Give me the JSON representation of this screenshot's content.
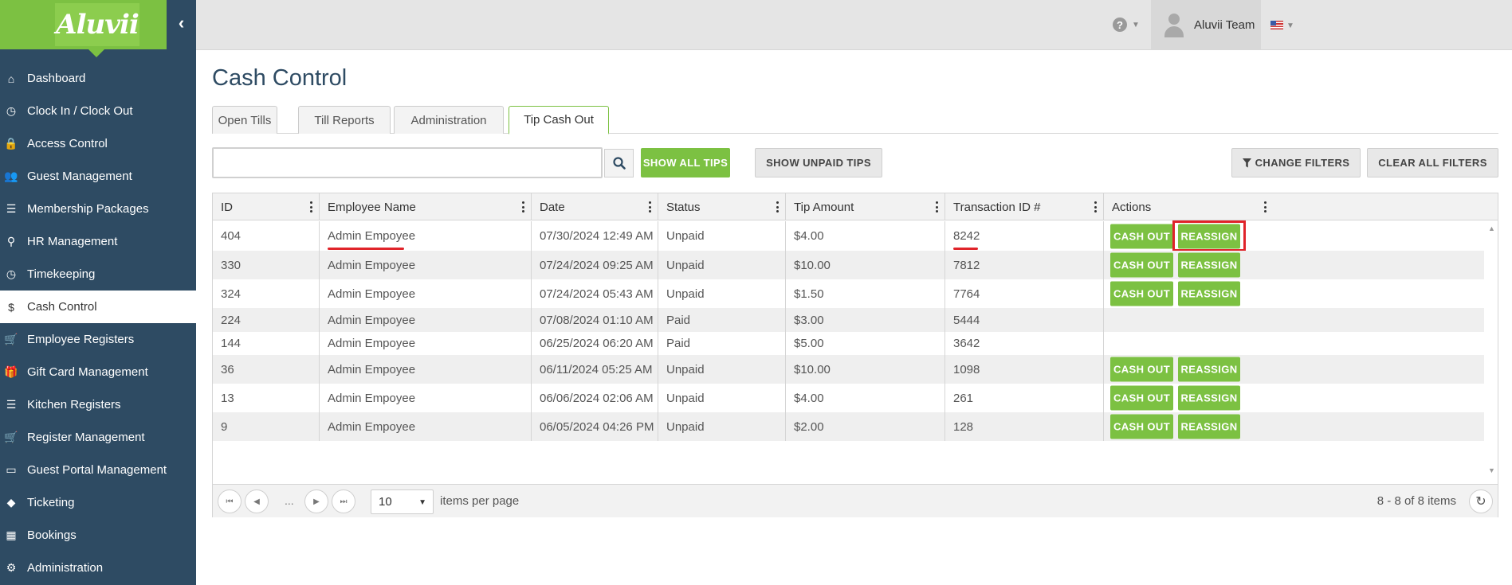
{
  "app": {
    "logo_text": "Aluvii"
  },
  "sidebar": {
    "items": [
      {
        "label": "Dashboard",
        "icon": "home-icon"
      },
      {
        "label": "Clock In / Clock Out",
        "icon": "clock-icon"
      },
      {
        "label": "Access Control",
        "icon": "lock-icon"
      },
      {
        "label": "Guest Management",
        "icon": "users-icon"
      },
      {
        "label": "Membership Packages",
        "icon": "list-icon"
      },
      {
        "label": "HR Management",
        "icon": "hr-icon"
      },
      {
        "label": "Timekeeping",
        "icon": "clock-icon"
      },
      {
        "label": "Cash Control",
        "icon": "dollar-icon",
        "active": true
      },
      {
        "label": "Employee Registers",
        "icon": "cart-icon"
      },
      {
        "label": "Gift Card Management",
        "icon": "gift-icon"
      },
      {
        "label": "Kitchen Registers",
        "icon": "list-icon"
      },
      {
        "label": "Register Management",
        "icon": "cart-icon"
      },
      {
        "label": "Guest Portal Management",
        "icon": "laptop-icon"
      },
      {
        "label": "Ticketing",
        "icon": "ticket-icon"
      },
      {
        "label": "Bookings",
        "icon": "calendar-icon"
      },
      {
        "label": "Administration",
        "icon": "cogs-icon"
      }
    ]
  },
  "header": {
    "user_name": "Aluvii Team",
    "help_icon": "question-circle-icon",
    "flag_icon": "us-flag-icon"
  },
  "page": {
    "title": "Cash Control"
  },
  "tabs": [
    {
      "label": "Open Tills"
    },
    {
      "label": "Till Reports"
    },
    {
      "label": "Administration"
    },
    {
      "label": "Tip Cash Out",
      "active": true
    }
  ],
  "toolbar": {
    "search_value": "",
    "show_all_tips": "SHOW ALL TIPS",
    "show_unpaid_tips": "SHOW UNPAID TIPS",
    "change_filters": "CHANGE FILTERS",
    "clear_all_filters": "CLEAR ALL FILTERS"
  },
  "grid": {
    "columns": [
      "ID",
      "Employee Name",
      "Date",
      "Status",
      "Tip Amount",
      "Transaction ID #",
      "Actions"
    ],
    "rows": [
      {
        "id": "404",
        "employee": "Admin Empoyee",
        "date": "07/30/2024 12:49 AM",
        "status": "Unpaid",
        "amount": "$4.00",
        "txn": "8242",
        "actions": true
      },
      {
        "id": "330",
        "employee": "Admin Empoyee",
        "date": "07/24/2024 09:25 AM",
        "status": "Unpaid",
        "amount": "$10.00",
        "txn": "7812",
        "actions": true
      },
      {
        "id": "324",
        "employee": "Admin Empoyee",
        "date": "07/24/2024 05:43 AM",
        "status": "Unpaid",
        "amount": "$1.50",
        "txn": "7764",
        "actions": true
      },
      {
        "id": "224",
        "employee": "Admin Empoyee",
        "date": "07/08/2024 01:10 AM",
        "status": "Paid",
        "amount": "$3.00",
        "txn": "5444",
        "actions": false
      },
      {
        "id": "144",
        "employee": "Admin Empoyee",
        "date": "06/25/2024 06:20 AM",
        "status": "Paid",
        "amount": "$5.00",
        "txn": "3642",
        "actions": false
      },
      {
        "id": "36",
        "employee": "Admin Empoyee",
        "date": "06/11/2024 05:25 AM",
        "status": "Unpaid",
        "amount": "$10.00",
        "txn": "1098",
        "actions": true
      },
      {
        "id": "13",
        "employee": "Admin Empoyee",
        "date": "06/06/2024 02:06 AM",
        "status": "Unpaid",
        "amount": "$4.00",
        "txn": "261",
        "actions": true
      },
      {
        "id": "9",
        "employee": "Admin Empoyee",
        "date": "06/05/2024 04:26 PM",
        "status": "Unpaid",
        "amount": "$2.00",
        "txn": "128",
        "actions": true
      }
    ],
    "cash_out_label": "CASH OUT",
    "reassign_label": "REASSIGN"
  },
  "pager": {
    "dots": "...",
    "page_size": "10",
    "items_per_page_label": "items per page",
    "info": "8 - 8 of 8 items"
  },
  "colors": {
    "sidebar_bg": "#2e4b63",
    "accent_green": "#7cc142",
    "highlight_red": "#e0242a"
  }
}
